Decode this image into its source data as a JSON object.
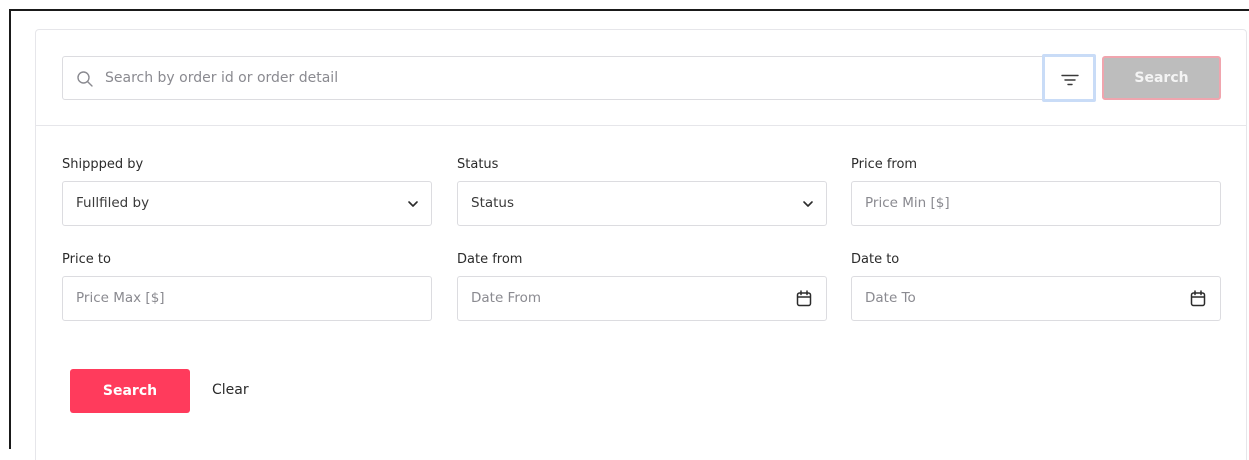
{
  "search": {
    "placeholder": "Search by order id or order detail",
    "button_label": "Search"
  },
  "filters": {
    "shipped_by": {
      "label": "Shippped by",
      "value": "Fullfiled by"
    },
    "status": {
      "label": "Status",
      "value": "Status"
    },
    "price_from": {
      "label": "Price from",
      "placeholder": "Price Min [$]"
    },
    "price_to": {
      "label": "Price to",
      "placeholder": "Price Max [$]"
    },
    "date_from": {
      "label": "Date from",
      "placeholder": "Date From"
    },
    "date_to": {
      "label": "Date to",
      "placeholder": "Date To"
    }
  },
  "actions": {
    "search_label": "Search",
    "clear_label": "Clear"
  },
  "icons": {
    "search": "search-icon",
    "filter": "filter-icon",
    "chevron": "chevron-down-icon",
    "calendar": "calendar-icon"
  },
  "colors": {
    "primary": "#ff3b5c",
    "disabled_button": "#bdbdbd",
    "focus_ring": "#c9dcf7",
    "border": "#dcdce0"
  }
}
